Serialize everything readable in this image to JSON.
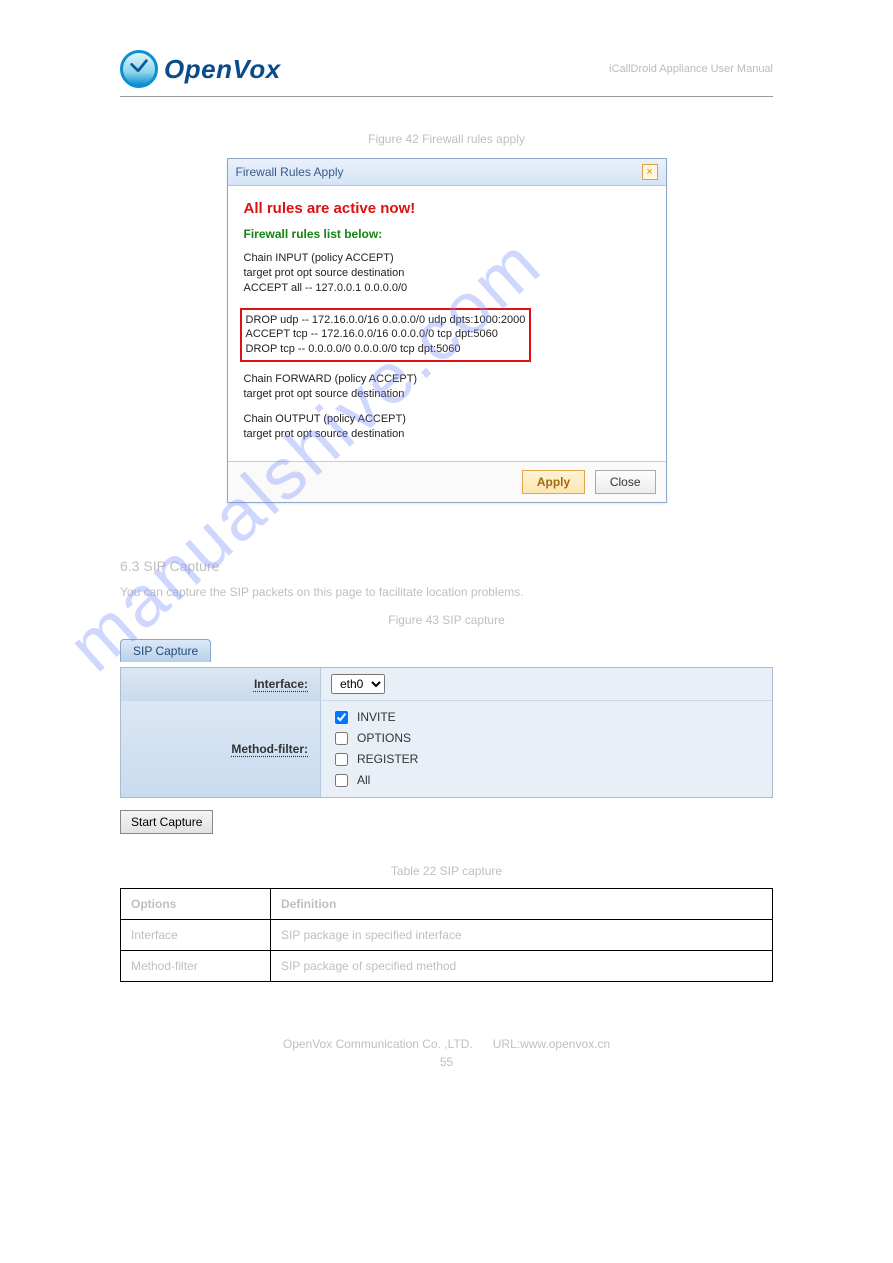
{
  "logo": {
    "text": "OpenVox"
  },
  "header_right": "iCallDroid Appliance User Manual",
  "figure_caption_1": "Figure 42 Firewall rules apply",
  "dialog": {
    "title": "Firewall Rules Apply",
    "close_glyph": "×",
    "msg_red": "All rules are active now!",
    "msg_green": "Firewall rules list below:",
    "chain_input_1": "Chain INPUT (policy ACCEPT)",
    "chain_input_2": "target prot opt source destination",
    "chain_input_3": "ACCEPT all -- 127.0.0.1 0.0.0.0/0",
    "box_1": "DROP udp -- 172.16.0.0/16 0.0.0.0/0 udp dpts:1000:2000",
    "box_2": "ACCEPT tcp -- 172.16.0.0/16 0.0.0.0/0 tcp dpt:5060",
    "box_3": "DROP tcp -- 0.0.0.0/0 0.0.0.0/0 tcp dpt:5060",
    "chain_fwd_1": "Chain FORWARD (policy ACCEPT)",
    "chain_fwd_2": "target prot opt source destination",
    "chain_out_1": "Chain OUTPUT (policy ACCEPT)",
    "chain_out_2": "target prot opt source destination",
    "apply_label": "Apply",
    "close_label": "Close"
  },
  "section_title": "6.3 SIP Capture",
  "section_para": "You can capture the SIP packets on this page to facilitate location problems.",
  "figure_caption_2": "Figure 43 SIP capture",
  "sip": {
    "tab": "SIP Capture",
    "interface_label": "Interface:",
    "interface_value": "eth0",
    "method_label": "Method-filter:",
    "invite": "INVITE",
    "options": "OPTIONS",
    "register": "REGISTER",
    "all": "All",
    "start_label": "Start Capture"
  },
  "table_caption": "Table 22 SIP capture",
  "desc_table": {
    "h1": "Options",
    "h2": "Definition",
    "r1c1": "Interface",
    "r1c2": "SIP package in specified interface",
    "r2c1": "Method-filter",
    "r2c2": "SIP package of specified method"
  },
  "footer": {
    "company": "OpenVox Communication Co. ,LTD.",
    "url": "URL:www.openvox.cn",
    "page": "55"
  },
  "watermark": "manualshive.com"
}
